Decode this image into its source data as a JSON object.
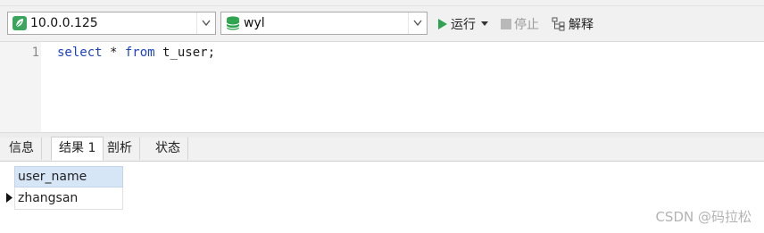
{
  "toolbar": {
    "connection": {
      "value": "10.0.0.125",
      "icon": "leaf-connection-icon"
    },
    "database": {
      "value": "wyl",
      "icon": "database-icon"
    },
    "run_label": "运行",
    "stop_label": "停止",
    "explain_label": "解释"
  },
  "editor": {
    "line_number": "1",
    "code": {
      "kw1": "select",
      "mid1": " * ",
      "kw2": "from",
      "rest": " t_user;"
    }
  },
  "tabs": [
    "信息",
    "结果 1",
    "剖析",
    "状态"
  ],
  "results": {
    "columns": [
      "user_name"
    ],
    "rows": [
      [
        "zhangsan"
      ]
    ]
  },
  "watermark": "CSDN @码拉松",
  "colors": {
    "accent_green": "#2ea44f",
    "keyword_blue": "#1d42c4",
    "header_blue": "#d6e6f7"
  }
}
